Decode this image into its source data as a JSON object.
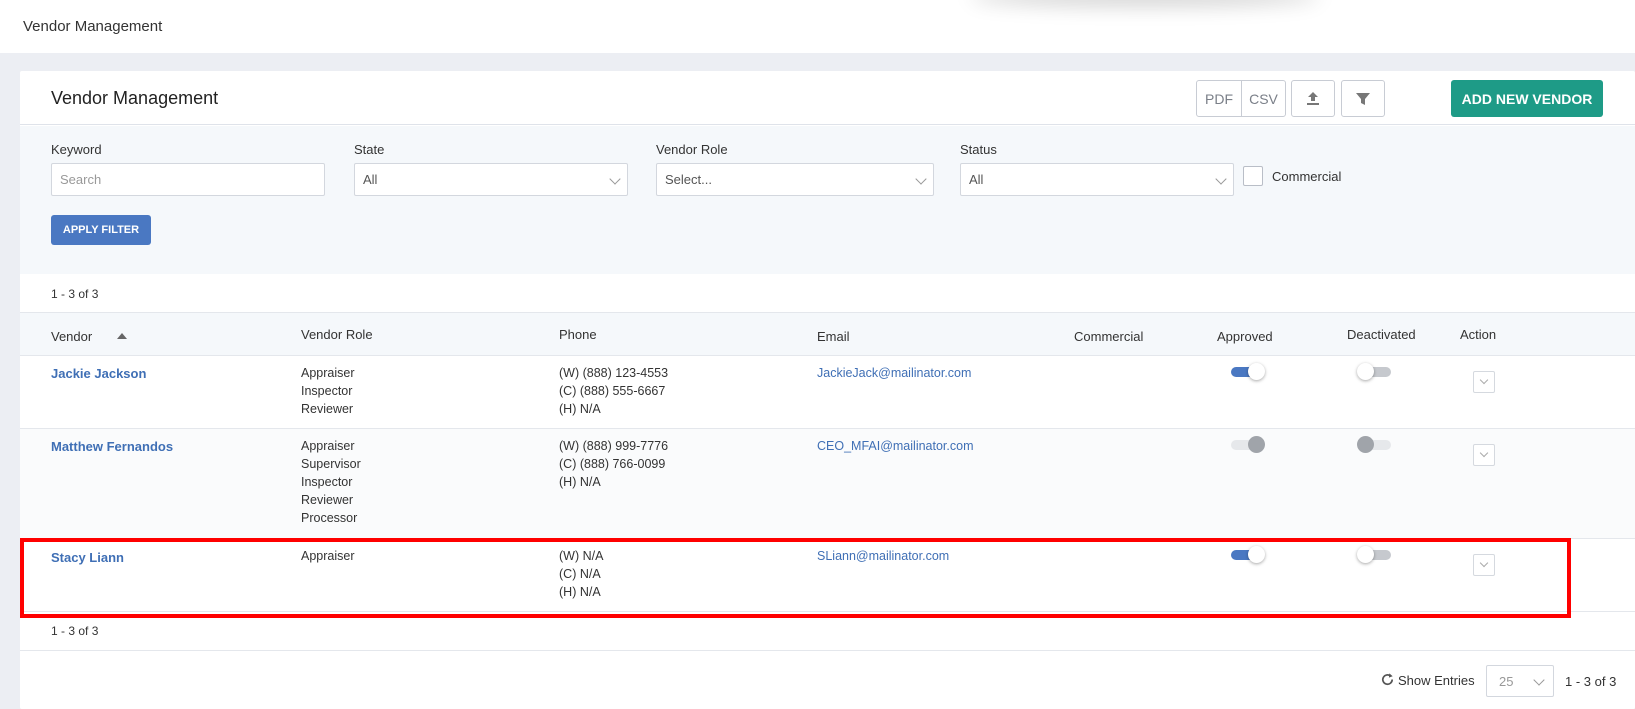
{
  "topbar": {
    "breadcrumb": "Vendor Management"
  },
  "header": {
    "title": "Vendor Management",
    "pdf_label": "PDF",
    "csv_label": "CSV",
    "add_label": "ADD NEW VENDOR"
  },
  "filters": {
    "keyword_label": "Keyword",
    "keyword_placeholder": "Search",
    "state_label": "State",
    "state_value": "All",
    "role_label": "Vendor Role",
    "role_value": "Select...",
    "status_label": "Status",
    "status_value": "All",
    "commercial_label": "Commercial",
    "apply_label": "APPLY FILTER"
  },
  "count_top": "1 - 3 of 3",
  "count_bottom": "1 - 3 of 3",
  "columns": [
    "Vendor",
    "Vendor Role",
    "Phone",
    "Email",
    "Commercial",
    "Approved",
    "Deactivated",
    "Action"
  ],
  "rows": [
    {
      "name": "Jackie Jackson",
      "roles": [
        "Appraiser",
        "Inspector",
        "Reviewer"
      ],
      "phones": [
        "(W) (888) 123-4553",
        "(C) (888) 555-6667",
        "(H) N/A"
      ],
      "email": "JackieJack@mailinator.com",
      "approved": true,
      "deactivated": false,
      "disabled": false
    },
    {
      "name": "Matthew Fernandos",
      "roles": [
        "Appraiser",
        "Supervisor",
        "Inspector",
        "Reviewer",
        "Processor"
      ],
      "phones": [
        "(W) (888) 999-7776",
        "(C) (888) 766-0099",
        "(H) N/A"
      ],
      "email": "CEO_MFAI@mailinator.com",
      "approved": true,
      "deactivated": false,
      "disabled": true
    },
    {
      "name": "Stacy Liann",
      "roles": [
        "Appraiser"
      ],
      "phones": [
        "(W) N/A",
        "(C) N/A",
        "(H) N/A"
      ],
      "email": "SLiann@mailinator.com",
      "approved": true,
      "deactivated": false,
      "disabled": false
    }
  ],
  "pagination": {
    "show_entries_label": "Show Entries",
    "entries_value": "25",
    "range": "1 - 3 of 3"
  },
  "colors": {
    "accent": "#4a78c2",
    "add_button": "#1e9b87",
    "highlight": "#ff0000"
  }
}
